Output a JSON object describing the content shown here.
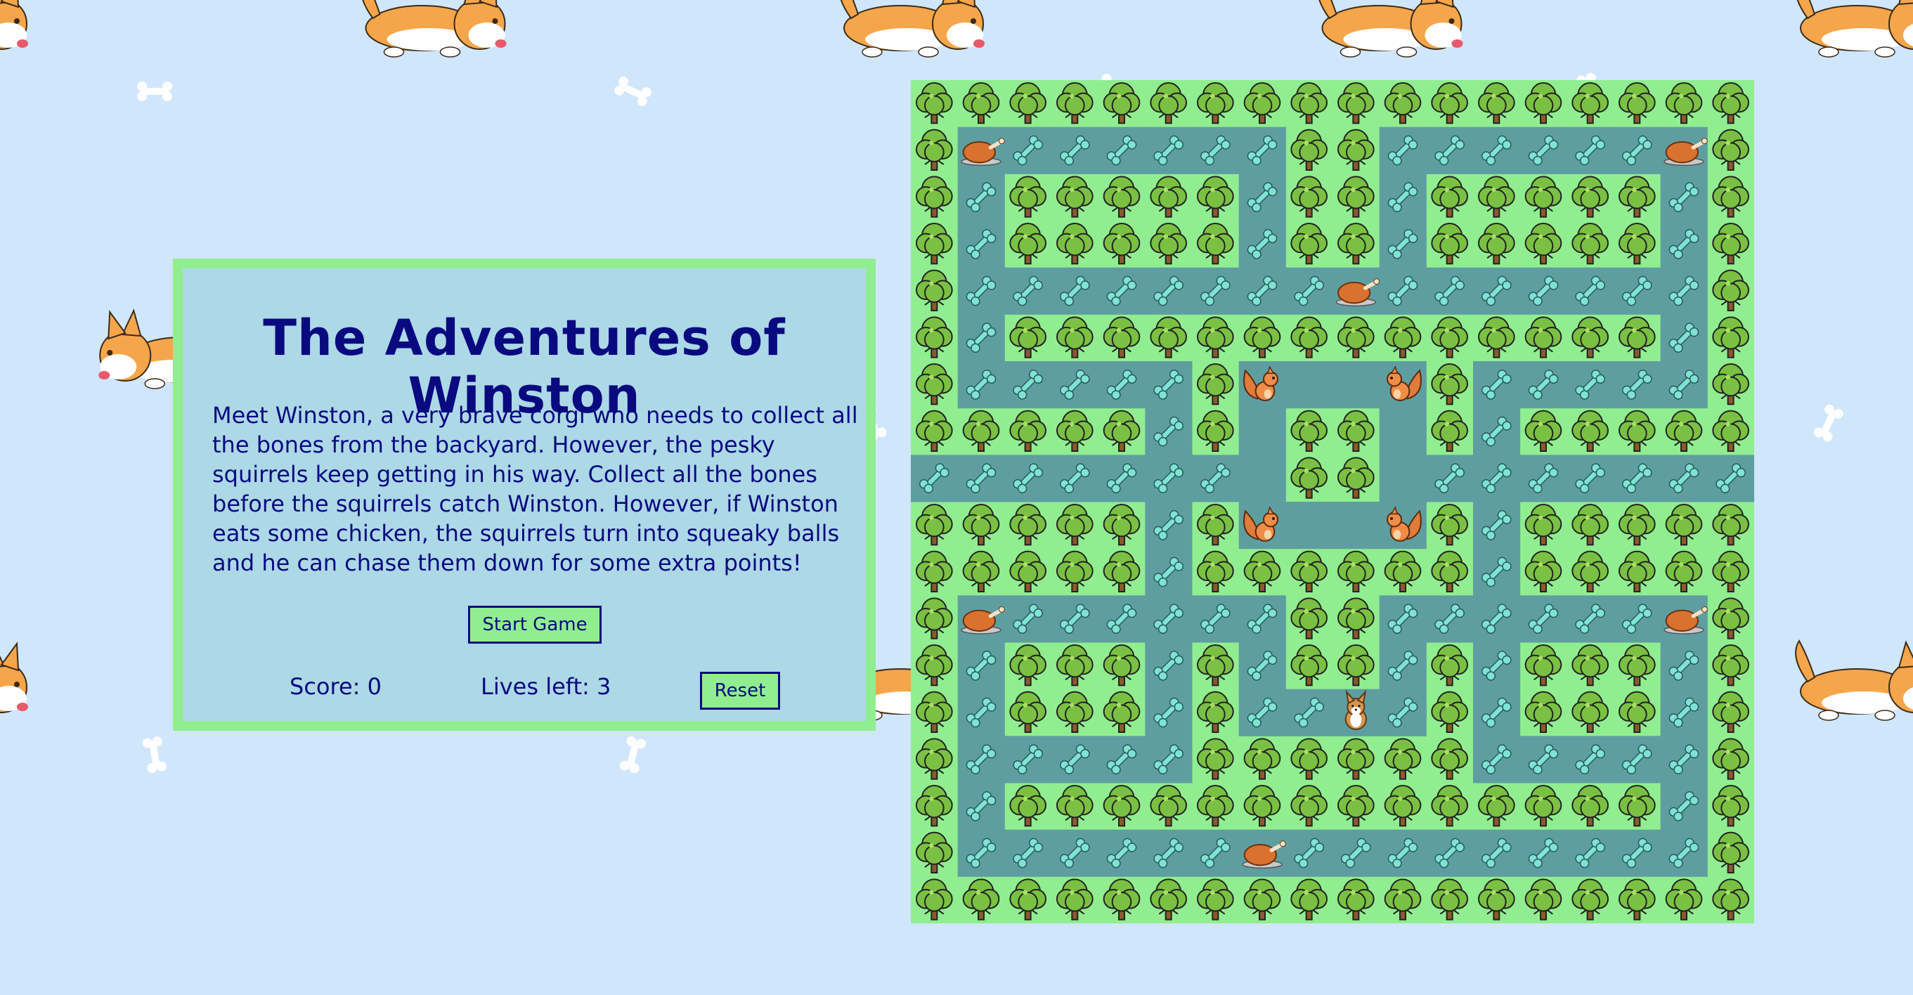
{
  "title": "The Adventures of Winston",
  "description": "Meet Winston, a very brave corgi who needs to collect all the bones from the backyard. However, the pesky squirrels keep getting in his way. Collect all the bones before the squirrels catch Winston. However, if Winston eats some chicken, the squirrels turn into squeaky balls and he can chase them down for some extra points!",
  "buttons": {
    "start": "Start Game",
    "reset": "Reset"
  },
  "stats": {
    "score_text": "Score: 0",
    "lives_text": "Lives left: 3"
  },
  "colors": {
    "background": "#d0e6fb",
    "panel": "#add8e6",
    "panel_border": "#90ee90",
    "text": "#0a0a80",
    "grass": "#90ee90",
    "path": "#5f9ea0",
    "bone": "#7fe3d4"
  },
  "maze": {
    "legend": {
      "T": "tree",
      "b": "bone",
      "C": "chicken",
      "S": "squirrel",
      "W": "winston",
      ".": "empty-path"
    },
    "rows": [
      "TTTTTTTTTTTTTTTTTT",
      "TCbbbbbbTTbbbbbbCT",
      "TbTTTTTbTTbTTTTTbT",
      "TbTTTTTbTTbTTTTTbT",
      "TbbbbbbbbCbbbbbbbT",
      "TbTTTTTTTTTTTTTTbT",
      "TbbbbbTS..STbbbbbT",
      "TTTTTbT.TT.TbTTTTT",
      "bbbbbbb.TT.bbbbbbb",
      "TTTTTbTS..STbTTTTT",
      "TTTTTbTTTTTTbTTTTT",
      "TCbbbbbbTTbbbbbbCT",
      "TbTTTbTbTTbTbTTTbT",
      "TbTTTbTbbWbTbTTTbT",
      "TbbbbbTTTTTTbbbbbT",
      "TbTTTTTTTTTTTTTTbT",
      "TbbbbbbCbbbbbbbbbT",
      "TTTTTTTTTTTTTTTTTT"
    ]
  }
}
